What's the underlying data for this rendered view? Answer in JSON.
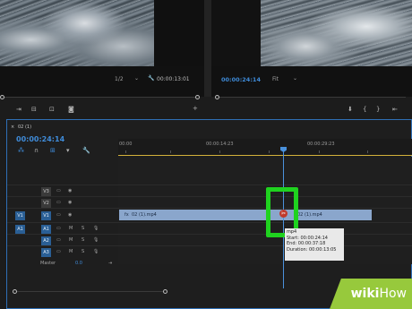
{
  "source_monitor": {
    "fraction": "1/2",
    "timecode": "00:00:13:01"
  },
  "program_monitor": {
    "timecode": "00:00:24:14",
    "fit": "Fit"
  },
  "timeline": {
    "tab_title": "02 (1)",
    "timecode": "00:00:24:14",
    "ruler_labels": [
      "00:00",
      "00:00:14:23",
      "00:00:29:23"
    ],
    "tracks": [
      {
        "id": "V3"
      },
      {
        "id": "V2"
      },
      {
        "id": "V1",
        "target": "V1"
      },
      {
        "id": "A1",
        "target": "A1"
      },
      {
        "id": "A2"
      },
      {
        "id": "A3"
      }
    ],
    "track_buttons": {
      "mute": "M",
      "solo": "S"
    },
    "master_label": "Master",
    "master_value": "0.0",
    "clip_left_label": "02 (1).mp4",
    "clip_right_label": "02 (1).mp4",
    "clip_fx": "fx",
    "audio_clip_label": "mp4"
  },
  "tooltip": {
    "name": "mp4",
    "start": "Start: 00:00:24:14",
    "end": "End: 00:00:37:18",
    "duration": "Duration: 00:00:13:05"
  },
  "watermark": {
    "wiki": "wiki",
    "how": "How"
  },
  "colors": {
    "accent": "#3f8bd8",
    "highlight": "#1fd21f",
    "clip": "#8aa6cc",
    "watermark": "#97c93c"
  }
}
